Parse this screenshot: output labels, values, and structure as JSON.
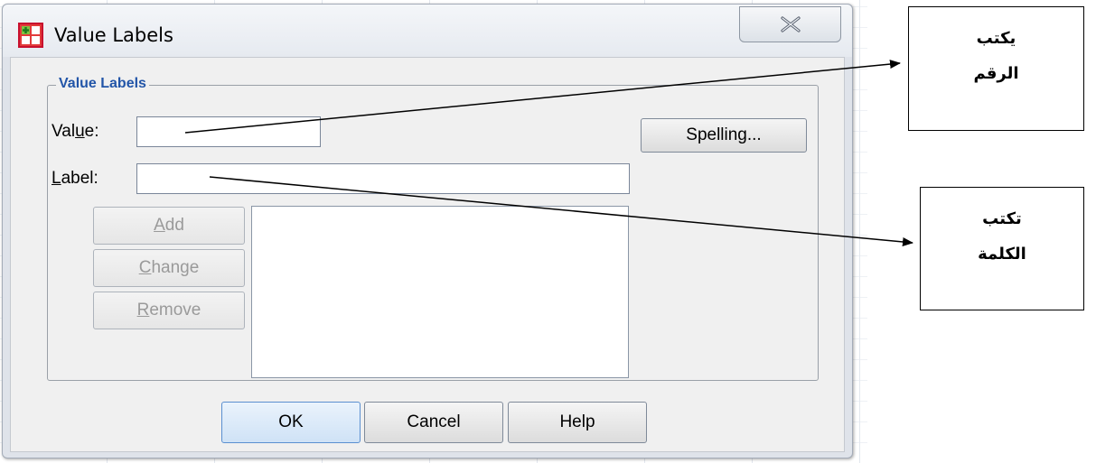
{
  "dialog": {
    "title": "Value Labels",
    "icon": "spss-grid-icon",
    "close_icon": "close-x-icon"
  },
  "group": {
    "legend": "Value Labels",
    "value_label_pre": "Val",
    "value_label_ul": "u",
    "value_label_post": "e:",
    "value_input": "",
    "label_label_ul": "L",
    "label_label_post": "abel:",
    "label_input": "",
    "spelling_button": "Spelling...",
    "add_ul": "A",
    "add_rest": "dd",
    "change_ul": "C",
    "change_rest": "hange",
    "remove_ul": "R",
    "remove_rest": "emove",
    "list_items": []
  },
  "footer": {
    "ok": "OK",
    "cancel": "Cancel",
    "help": "Help"
  },
  "annotations": {
    "value_note_line1": "يكتب",
    "value_note_line2": "الرقم",
    "label_note_line1": "تكتب",
    "label_note_line2": "الكلمة"
  }
}
